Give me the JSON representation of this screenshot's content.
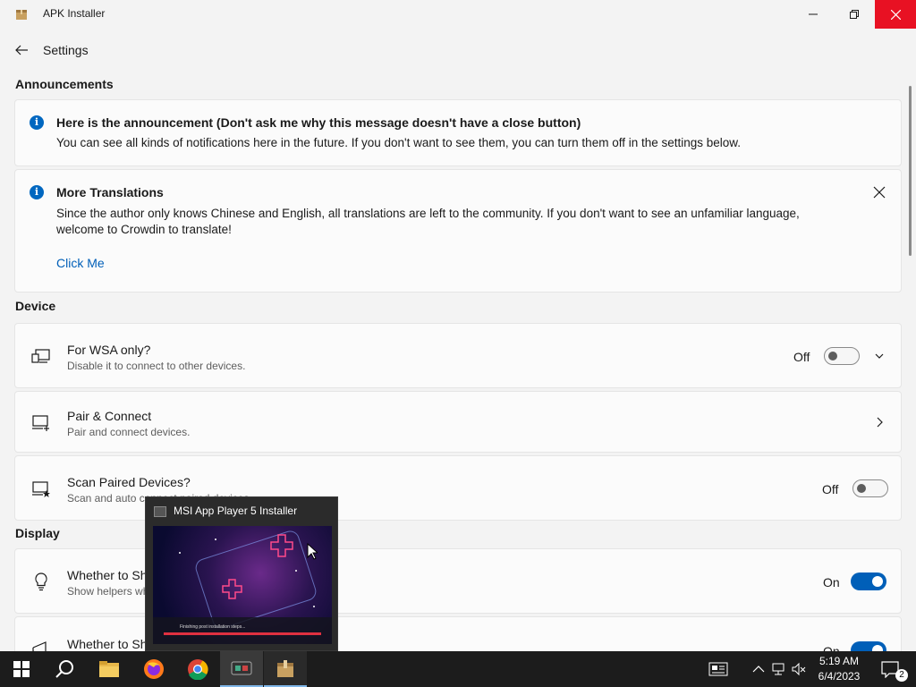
{
  "window": {
    "title": "APK Installer"
  },
  "header": {
    "title": "Settings"
  },
  "announcements": {
    "section_title": "Announcements",
    "items": [
      {
        "title": "Here is the announcement (Don't ask me why this message doesn't have a close button)",
        "message": "You can see all kinds of notifications here in the future. If you don't want to see them, you can turn them off in the settings below."
      },
      {
        "title": "More Translations",
        "message": "Since the author only knows Chinese and English, all translations are left to the community. If you don't want to see an unfamiliar language, welcome to Crowdin to translate!",
        "link": "Click Me"
      }
    ]
  },
  "device": {
    "section_title": "Device",
    "rows": [
      {
        "title": "For WSA only?",
        "desc": "Disable it to connect to other devices.",
        "toggle_label": "Off",
        "toggle_on": false
      },
      {
        "title": "Pair & Connect",
        "desc": "Pair and connect devices."
      },
      {
        "title": "Scan Paired Devices?",
        "desc": "Scan and auto connect paired devices.",
        "toggle_label": "Off",
        "toggle_on": false
      }
    ]
  },
  "display": {
    "section_title": "Display",
    "rows": [
      {
        "title": "Whether to Show",
        "desc": "Show helpers wh",
        "toggle_label": "On",
        "toggle_on": true
      },
      {
        "title": "Whether to Show Announcements?",
        "toggle_label": "On",
        "toggle_on": true
      }
    ]
  },
  "taskbar_preview": {
    "title": "MSI App Player 5 Installer",
    "thumb_text": "Finishing post installation steps..."
  },
  "tray": {
    "time": "5:19 AM",
    "date": "6/4/2023",
    "notification_count": "2"
  },
  "colors": {
    "accent": "#005fb8",
    "close_red": "#e81123",
    "taskbar": "#1c1c1c"
  }
}
